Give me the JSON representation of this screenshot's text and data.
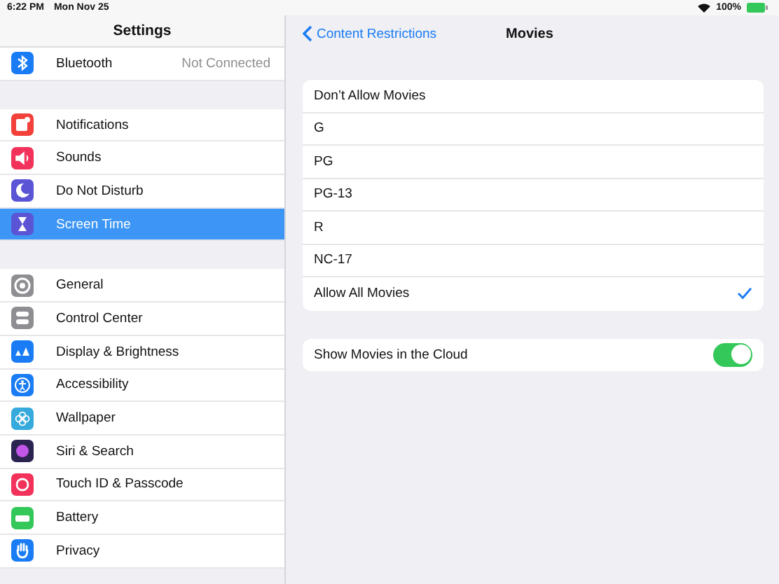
{
  "status_bar": {
    "time": "6:22 PM",
    "date": "Mon Nov 25",
    "battery": "100%"
  },
  "sidebar": {
    "title": "Settings",
    "groups": [
      {
        "items": [
          {
            "label": "Bluetooth",
            "value": "Not Connected",
            "kind": "bluetooth",
            "color": "#1a7cf5",
            "selected": false
          }
        ]
      },
      {
        "items": [
          {
            "label": "Notifications",
            "kind": "notifications",
            "color": "#f2403a",
            "selected": false
          },
          {
            "label": "Sounds",
            "kind": "sounds",
            "color": "#f2325a",
            "selected": false
          },
          {
            "label": "Do Not Disturb",
            "kind": "moon",
            "color": "#5b55d6",
            "selected": false
          },
          {
            "label": "Screen Time",
            "kind": "hourglass",
            "color": "#5b55d6",
            "selected": true
          }
        ]
      },
      {
        "items": [
          {
            "label": "General",
            "kind": "gear",
            "color": "#8e8e93",
            "selected": false
          },
          {
            "label": "Control Center",
            "kind": "switches",
            "color": "#8e8e93",
            "selected": false
          },
          {
            "label": "Display & Brightness",
            "kind": "text",
            "color": "#1a7cf5",
            "selected": false
          },
          {
            "label": "Accessibility",
            "kind": "person",
            "color": "#1a7cf5",
            "selected": false
          },
          {
            "label": "Wallpaper",
            "kind": "flower",
            "color": "#36aadc",
            "selected": false
          },
          {
            "label": "Siri & Search",
            "kind": "siri",
            "color": "#2b2350",
            "selected": false
          },
          {
            "label": "Touch ID & Passcode",
            "kind": "fingerprint",
            "color": "#f2325a",
            "selected": false
          },
          {
            "label": "Battery",
            "kind": "battery",
            "color": "#34c759",
            "selected": false
          },
          {
            "label": "Privacy",
            "kind": "hand",
            "color": "#1a7cf5",
            "selected": false
          }
        ]
      }
    ]
  },
  "detail": {
    "back": "Content Restrictions",
    "title": "Movies",
    "options": [
      {
        "label": "Don’t Allow Movies",
        "selected": false
      },
      {
        "label": "G",
        "selected": false
      },
      {
        "label": "PG",
        "selected": false
      },
      {
        "label": "PG-13",
        "selected": false
      },
      {
        "label": "R",
        "selected": false
      },
      {
        "label": "NC-17",
        "selected": false
      },
      {
        "label": "Allow All Movies",
        "selected": true
      }
    ],
    "cloud": {
      "label": "Show Movies in the Cloud",
      "on": true
    }
  }
}
